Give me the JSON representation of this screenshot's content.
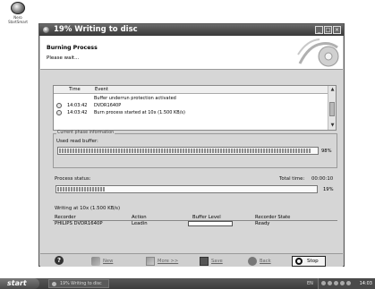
{
  "desktop": {
    "icon_label": "Nero\nStartSmart",
    "icon_name": "nero-startsmart-icon"
  },
  "window": {
    "title": "19% Writing to disc",
    "min": "_",
    "max": "□",
    "close": "×"
  },
  "header": {
    "title": "Burning Process",
    "subtitle": "Please wait..."
  },
  "log": {
    "columns": [
      "Time",
      "Event"
    ],
    "rows": [
      {
        "time": "",
        "event": "Buffer underrun protection activated",
        "icon": ""
      },
      {
        "time": "14:03:42",
        "event": "DVDR1640P",
        "icon": "info-icon"
      },
      {
        "time": "14:03:42",
        "event": "Burn process started at 10x (1.500 KB/s)",
        "icon": "info-icon"
      }
    ]
  },
  "phase": {
    "legend": "Current phase information",
    "buffer_label": "Used read buffer:",
    "buffer_pct_text": "98%",
    "buffer_value": 0.98,
    "status_label": "Process status:",
    "total_time_label": "Total time:",
    "total_time": "00:00:10",
    "status_pct_text": "19%",
    "status_value": 0.19
  },
  "writing_status": "Writing at 10x (1.500 KB/s)",
  "recorders": {
    "columns": [
      "Recorder",
      "Action",
      "Buffer Level",
      "Recorder State"
    ],
    "rows": [
      {
        "recorder": "PHILIPS DVDR1640P",
        "action": "Leadin",
        "state": "Ready"
      }
    ]
  },
  "buttons": {
    "new": "New",
    "more": "More >>",
    "save": "Save",
    "back": "Back",
    "stop": "Stop"
  },
  "taskbar": {
    "start": "start",
    "task": "19% Writing to disc",
    "lang": "EN",
    "clock": "14:03"
  }
}
